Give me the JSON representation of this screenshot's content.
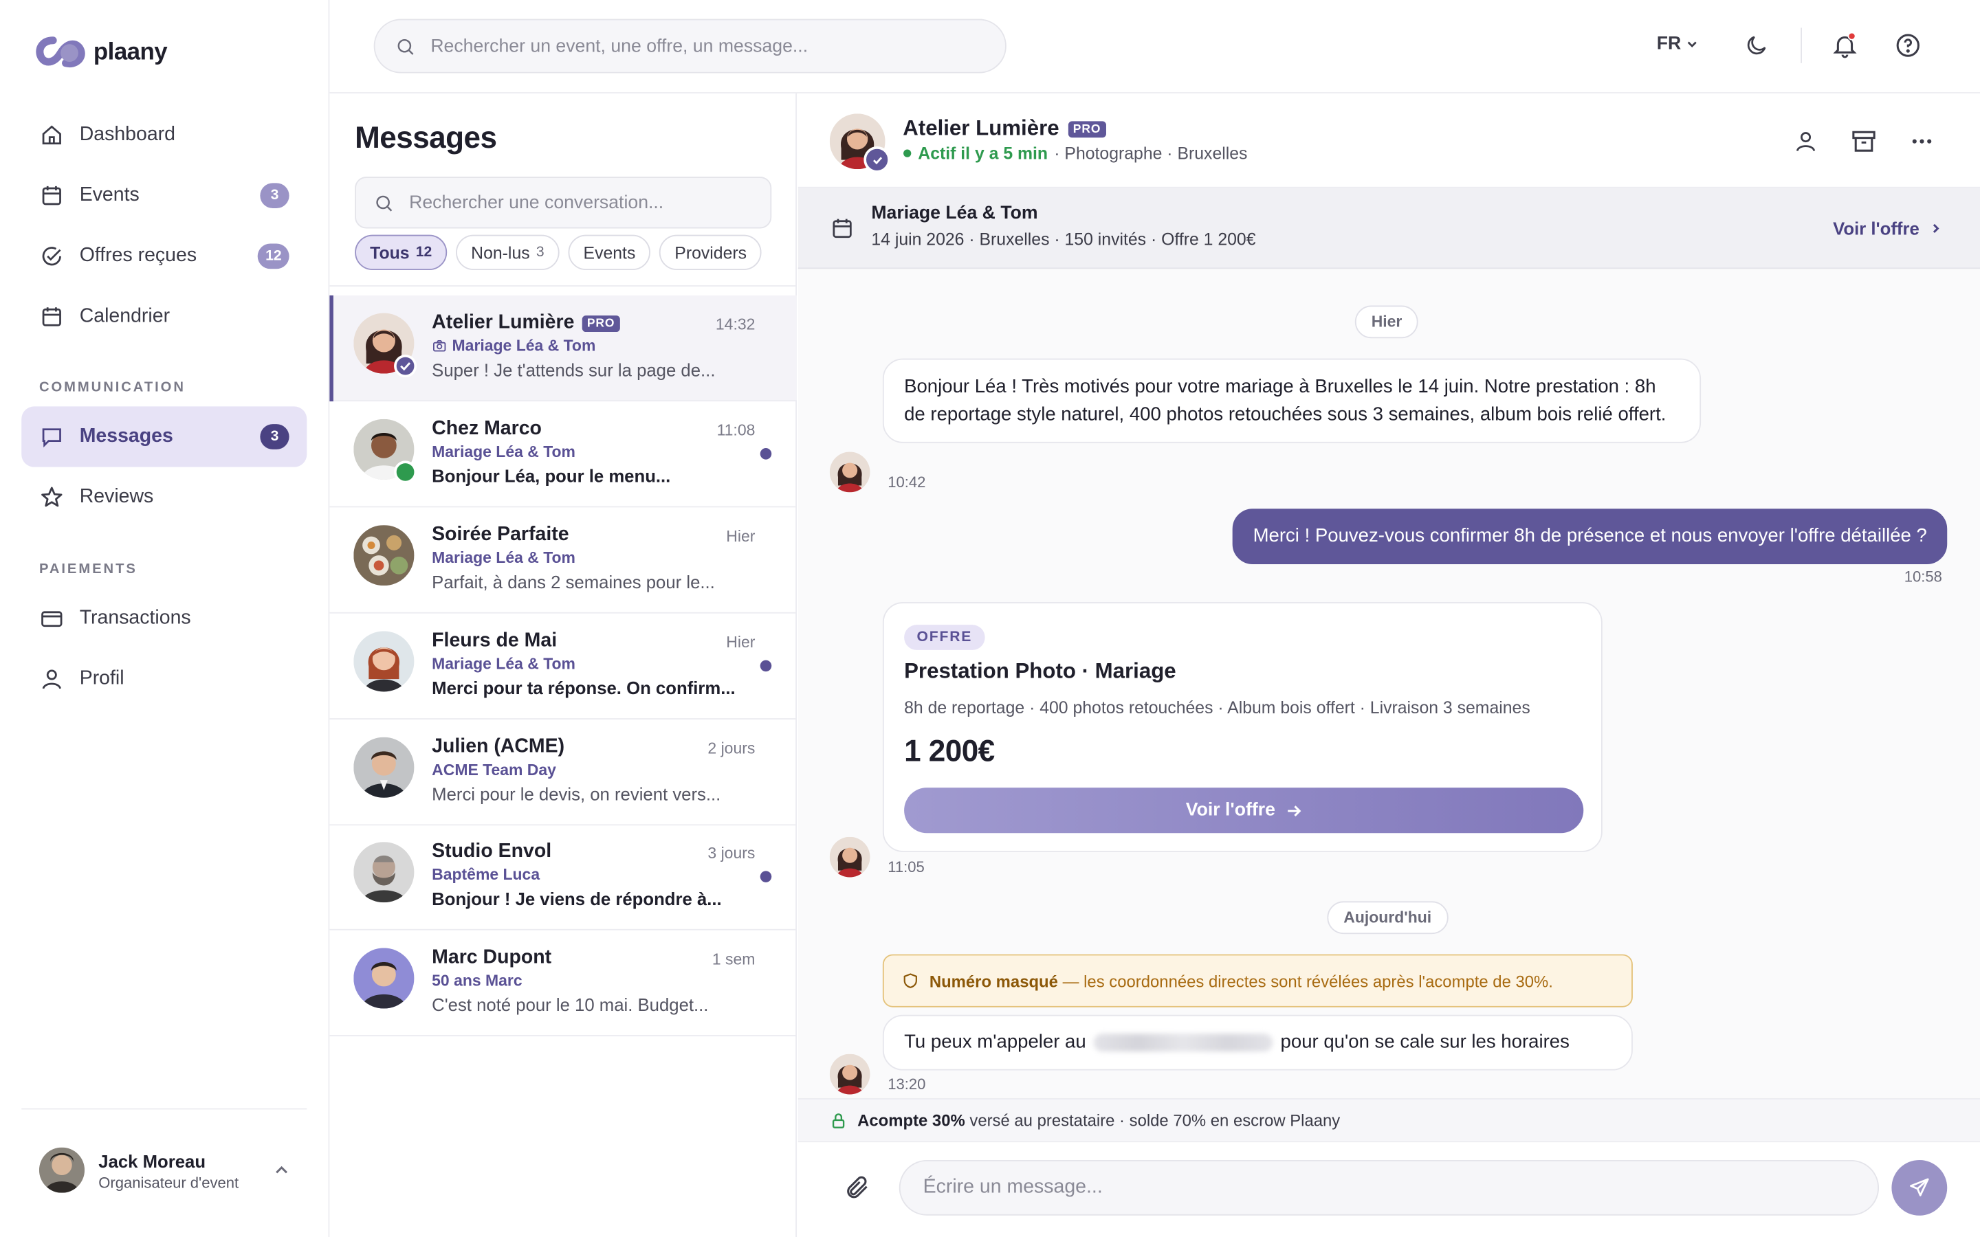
{
  "app": {
    "name": "plaany"
  },
  "sidebar": {
    "nav": [
      {
        "label": "Dashboard",
        "icon": "home-icon"
      },
      {
        "label": "Events",
        "icon": "calendar-icon",
        "badge": "3"
      },
      {
        "label": "Offres reçues",
        "icon": "check-circle-icon",
        "badge": "12"
      },
      {
        "label": "Calendrier",
        "icon": "calendar-icon"
      }
    ],
    "section_communication": "COMMUNICATION",
    "comm": [
      {
        "label": "Messages",
        "icon": "chat-icon",
        "badge": "3",
        "active": true
      },
      {
        "label": "Reviews",
        "icon": "star-icon"
      }
    ],
    "section_payments": "PAIEMENTS",
    "pay": [
      {
        "label": "Transactions",
        "icon": "card-icon"
      },
      {
        "label": "Profil",
        "icon": "user-icon"
      }
    ],
    "user": {
      "name": "Jack Moreau",
      "role": "Organisateur d'event"
    }
  },
  "topbar": {
    "search_placeholder": "Rechercher un event, une offre, un message...",
    "lang": "FR"
  },
  "messages": {
    "title": "Messages",
    "search_placeholder": "Rechercher une conversation...",
    "filters": [
      {
        "label": "Tous",
        "count": "12",
        "active": true
      },
      {
        "label": "Non-lus",
        "count": "3"
      },
      {
        "label": "Events",
        "count": ""
      },
      {
        "label": "Providers",
        "count": ""
      }
    ],
    "conversations": [
      {
        "name": "Atelier Lumière",
        "pro": "PRO",
        "time": "14:32",
        "event": "Mariage Léa & Tom",
        "preview": "Super ! Je t'attends sur la page de...",
        "unread": false,
        "selected": true
      },
      {
        "name": "Chez Marco",
        "time": "11:08",
        "event": "Mariage Léa & Tom",
        "preview": "Bonjour Léa, pour le menu...",
        "unread": true
      },
      {
        "name": "Soirée Parfaite",
        "time": "Hier",
        "event": "Mariage Léa & Tom",
        "preview": "Parfait, à dans 2 semaines pour le...",
        "unread": false
      },
      {
        "name": "Fleurs de Mai",
        "time": "Hier",
        "event": "Mariage Léa & Tom",
        "preview": "Merci pour ta réponse. On confirm...",
        "unread": true
      },
      {
        "name": "Julien (ACME)",
        "time": "2 jours",
        "event": "ACME Team Day",
        "preview": "Merci pour le devis, on revient vers...",
        "unread": false
      },
      {
        "name": "Studio Envol",
        "time": "3 jours",
        "event": "Baptême Luca",
        "preview": "Bonjour ! Je viens de répondre à...",
        "unread": true
      },
      {
        "name": "Marc Dupont",
        "time": "1 sem",
        "event": "50 ans Marc",
        "preview": "C'est noté pour le 10 mai. Budget...",
        "unread": false
      }
    ]
  },
  "chat": {
    "contact": {
      "name": "Atelier Lumière",
      "pro": "PRO",
      "status": "Actif il y a 5 min",
      "meta": "· Photographe · Bruxelles"
    },
    "event": {
      "title": "Mariage Léa & Tom",
      "details": "14 juin 2026 · Bruxelles · 150 invités · Offre 1 200€",
      "link": "Voir l'offre"
    },
    "day_yesterday": "Hier",
    "msg1": {
      "text": "Bonjour Léa ! Très motivés pour votre mariage à Bruxelles le 14 juin. Notre prestation : 8h de reportage style naturel, 400 photos retouchées sous 3 semaines, album bois relié offert.",
      "time": "10:42"
    },
    "msg2": {
      "text": "Merci ! Pouvez-vous confirmer 8h de présence et nous envoyer l'offre détaillée ?",
      "time": "10:58"
    },
    "offer": {
      "tag": "OFFRE",
      "title": "Prestation Photo · Mariage",
      "details": "8h de reportage · 400 photos retouchées · Album bois offert · Livraison 3 semaines",
      "price": "1 200€",
      "button": "Voir l'offre",
      "time": "11:05"
    },
    "day_today": "Aujourd'hui",
    "warning": {
      "strong": "Numéro masqué",
      "text": "— les coordonnées directes sont révélées après l'acompte de 30%."
    },
    "msg3": {
      "before": "Tu peux m'appeler au",
      "after": "pour qu'on se cale sur les horaires",
      "time": "13:20"
    },
    "escrow": {
      "strong": "Acompte 30%",
      "text": "versé au prestataire · solde 70% en escrow Plaany"
    },
    "composer_placeholder": "Écrire un message..."
  },
  "colors": {
    "accent": "#5f5799",
    "accent_light": "#e7e3f6",
    "online": "#2e9a4e",
    "warning_bg": "#fdf4e3"
  }
}
